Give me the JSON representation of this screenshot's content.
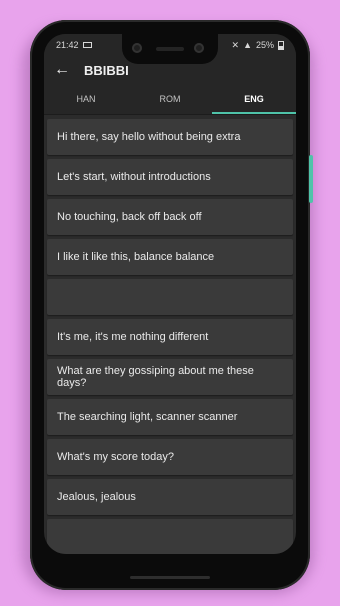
{
  "status": {
    "time": "21:42",
    "battery": "25%"
  },
  "header": {
    "title": "BBIBBI"
  },
  "tabs": [
    {
      "label": "HAN",
      "active": false
    },
    {
      "label": "ROM",
      "active": false
    },
    {
      "label": "ENG",
      "active": true
    }
  ],
  "lyrics": [
    "Hi there, say hello without being extra",
    "Let's start, without introductions",
    "No touching, back off back off",
    "I like it like this, balance balance",
    "",
    "It's me, it's me nothing different",
    "What are they gossiping about me these days?",
    "The searching light, scanner scanner",
    "What's my score today?",
    "Jealous, jealous",
    ""
  ],
  "colors": {
    "accent": "#4fc3a9",
    "background": "#e8a3ec"
  }
}
